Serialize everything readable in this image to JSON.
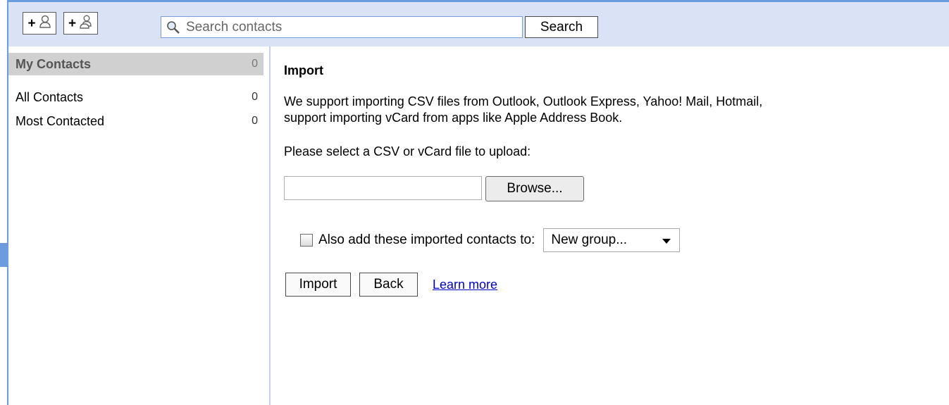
{
  "toolbar": {
    "add_contact_icon": "add-contact-icon",
    "add_group_icon": "add-group-icon",
    "search_placeholder": "Search contacts",
    "search_button": "Search"
  },
  "sidebar": {
    "header": {
      "label": "My Contacts",
      "count": "0"
    },
    "items": [
      {
        "label": "All Contacts",
        "count": "0"
      },
      {
        "label": "Most Contacted",
        "count": "0"
      }
    ]
  },
  "main": {
    "title": "Import",
    "description_line1": "We support importing CSV files from Outlook, Outlook Express, Yahoo! Mail, Hotmail,",
    "description_line2": "support importing vCard from apps like Apple Address Book.",
    "select_prompt": "Please select a CSV or vCard file to upload:",
    "browse_button": "Browse...",
    "group_checkbox_label": "Also add these imported contacts to:",
    "group_select_value": "New group...",
    "import_button": "Import",
    "back_button": "Back",
    "learn_more_link": "Learn more"
  },
  "colors": {
    "frame": "#6d9be0",
    "toolbar_bg": "#d9e3f5",
    "link": "#0000cc",
    "sidebar_selected": "#d0d0d0"
  }
}
